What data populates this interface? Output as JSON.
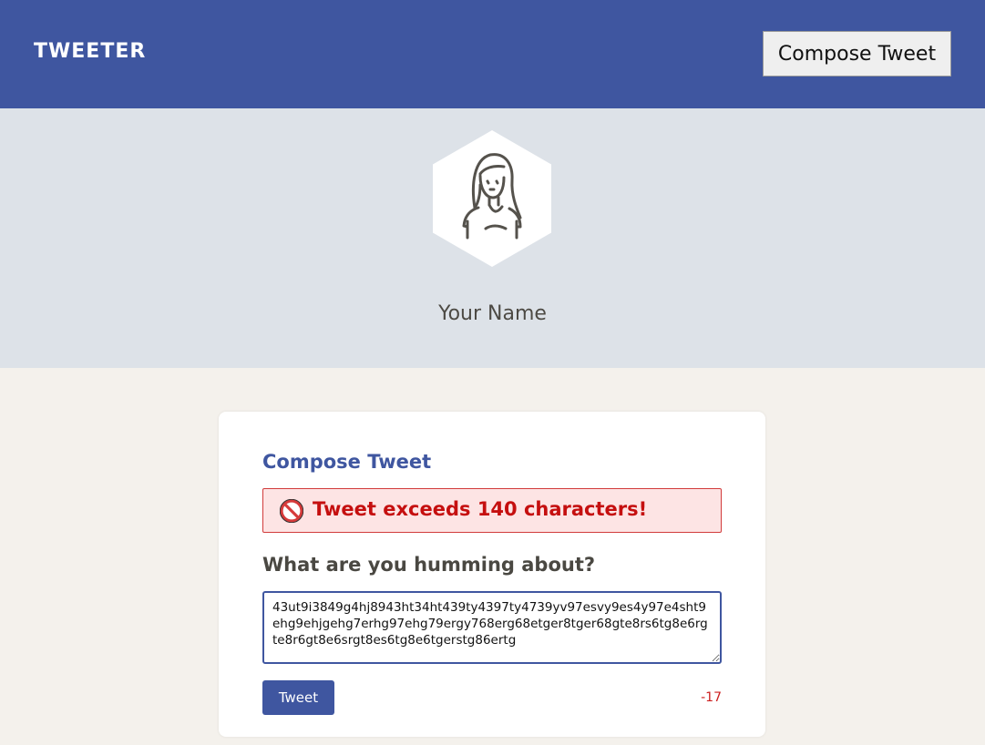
{
  "nav": {
    "logo": "TWEETER",
    "compose_button": "Compose Tweet"
  },
  "profile": {
    "name": "Your Name",
    "avatar_icon": "user-avatar-icon"
  },
  "compose": {
    "title": "Compose Tweet",
    "error_icon": "no-entry-icon",
    "error_message": "Tweet exceeds 140 characters!",
    "question": "What are you humming about?",
    "tweet_text": "43ut9i3849g4hj8943ht34ht439ty4397ty4739yv97esvy9es4y97e4sht9ehg9ehjgehg7erhg97ehg79ergy768erg68etger8tger68gte8rs6tg8e6rgte8r6gt8e6srgt8es6tg8e6tgerstg86ertg",
    "submit_label": "Tweet",
    "counter": "-17"
  },
  "colors": {
    "brand": "#3f56a0",
    "error": "#c50f0f",
    "error_bg": "#fde4e4"
  }
}
